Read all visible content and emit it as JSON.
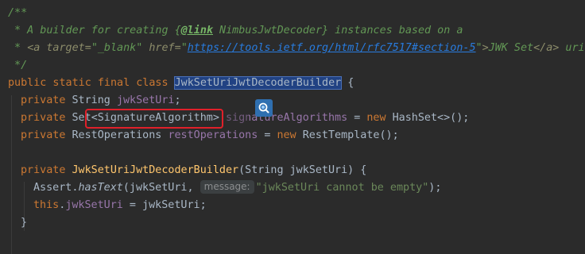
{
  "code": {
    "l1_open": "/**",
    "l2_prefix": " * A builder for creating {",
    "l2_link_tag": "@link",
    "l2_link_target": " NimbusJwtDecoder",
    "l2_suffix": "} instances based on a",
    "l3_prefix": " * ",
    "l3_a_open": "<a target=",
    "l3_target_val": "\"_blank\"",
    "l3_href": " href=",
    "l3_url_q1": "\"",
    "l3_url": "https://tools.ietf.org/html/rfc7517#section-5",
    "l3_url_q2": "\"",
    "l3_gt": ">",
    "l3_text": "JWK Set",
    "l3_a_close": "</a>",
    "l3_suffix": " uri.",
    "l4_close": " */",
    "l5_kw": "public static final class ",
    "l5_class": "JwkSetUriJwtDecoderBuilder",
    "l5_brace": " {",
    "l6_kw": "private ",
    "l6_type": "String ",
    "l6_field": "jwkSetUri",
    "l6_semi": ";",
    "l7_kw": "private ",
    "l7_type_a": "Set",
    "l7_generic": "<SignatureAlgorithm>",
    "l7_space": " ",
    "l7_field": "signatureAlgorithms",
    "l7_eq": " = ",
    "l7_new": "new ",
    "l7_rest": "HashSet<>();",
    "l8_kw": "private ",
    "l8_type": "RestOperations ",
    "l8_field": "restOperations",
    "l8_eq": " = ",
    "l8_new": "new ",
    "l8_rest": "RestTemplate();",
    "l10_kw": "private ",
    "l10_ctor": "JwkSetUriJwtDecoderBuilder",
    "l10_params": "(String jwkSetUri) {",
    "l11_a": "Assert.",
    "l11_method": "hasText",
    "l11_args": "(jwkSetUri, ",
    "l11_hint": "message:",
    "l11_str": "\"jwkSetUri cannot be empty\"",
    "l11_end": ");",
    "l12_this": "this",
    "l12_dot": ".",
    "l12_field": "jwkSetUri",
    "l12_rest": " = jwkSetUri;",
    "l13_brace": "}"
  },
  "colors": {
    "background": "#2b2b2b",
    "highlight_box": "#e0202a",
    "selection": "#214283"
  },
  "icons": {
    "overlay": "search-magnifier-icon"
  }
}
